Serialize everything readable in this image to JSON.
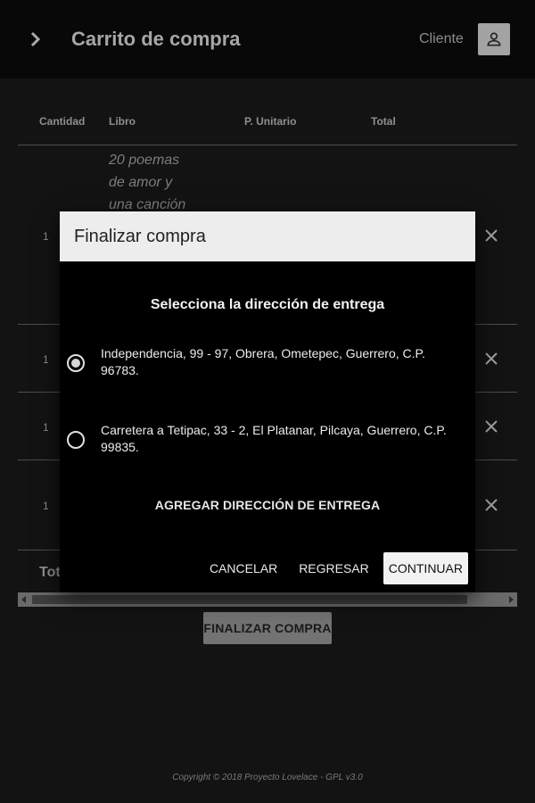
{
  "header": {
    "title": "Carrito de compra",
    "user_label": "Cliente"
  },
  "table": {
    "columns": [
      "Cantidad",
      "Libro",
      "P. Unitario",
      "Total"
    ],
    "rows": [
      {
        "qty": "1",
        "book": "20 poemas de amor y una canción"
      },
      {
        "qty": "1",
        "book": ""
      },
      {
        "qty": "1",
        "book": ""
      },
      {
        "qty": "1",
        "book": ""
      }
    ],
    "total_label": "Tot"
  },
  "finish_button": "FINALIZAR COMPRA",
  "footer": "Copyright © 2018 Proyecto Lovelace - GPL v3.0",
  "dialog": {
    "title": "Finalizar compra",
    "subtitle": "Selecciona la dirección de entrega",
    "addresses": [
      {
        "text": "Independencia, 99 - 97, Obrera, Ometepec, Guerrero, C.P. 96783.",
        "selected": true
      },
      {
        "text": "Carretera a Tetipac, 33 - 2, El Platanar, Pilcaya, Guerrero, C.P. 99835.",
        "selected": false
      }
    ],
    "add_address": "AGREGAR DIRECCIÓN DE ENTREGA",
    "actions": {
      "cancel": "CANCELAR",
      "back": "REGRESAR",
      "continue": "CONTINUAR"
    }
  },
  "icons": {
    "menu": "chevron-right-icon",
    "user": "person-icon",
    "delete": "close-icon"
  },
  "colors": {
    "background": "#131313",
    "toolbar": "#080808",
    "dialog_header": "#ededed",
    "dialog_body": "#000000"
  }
}
